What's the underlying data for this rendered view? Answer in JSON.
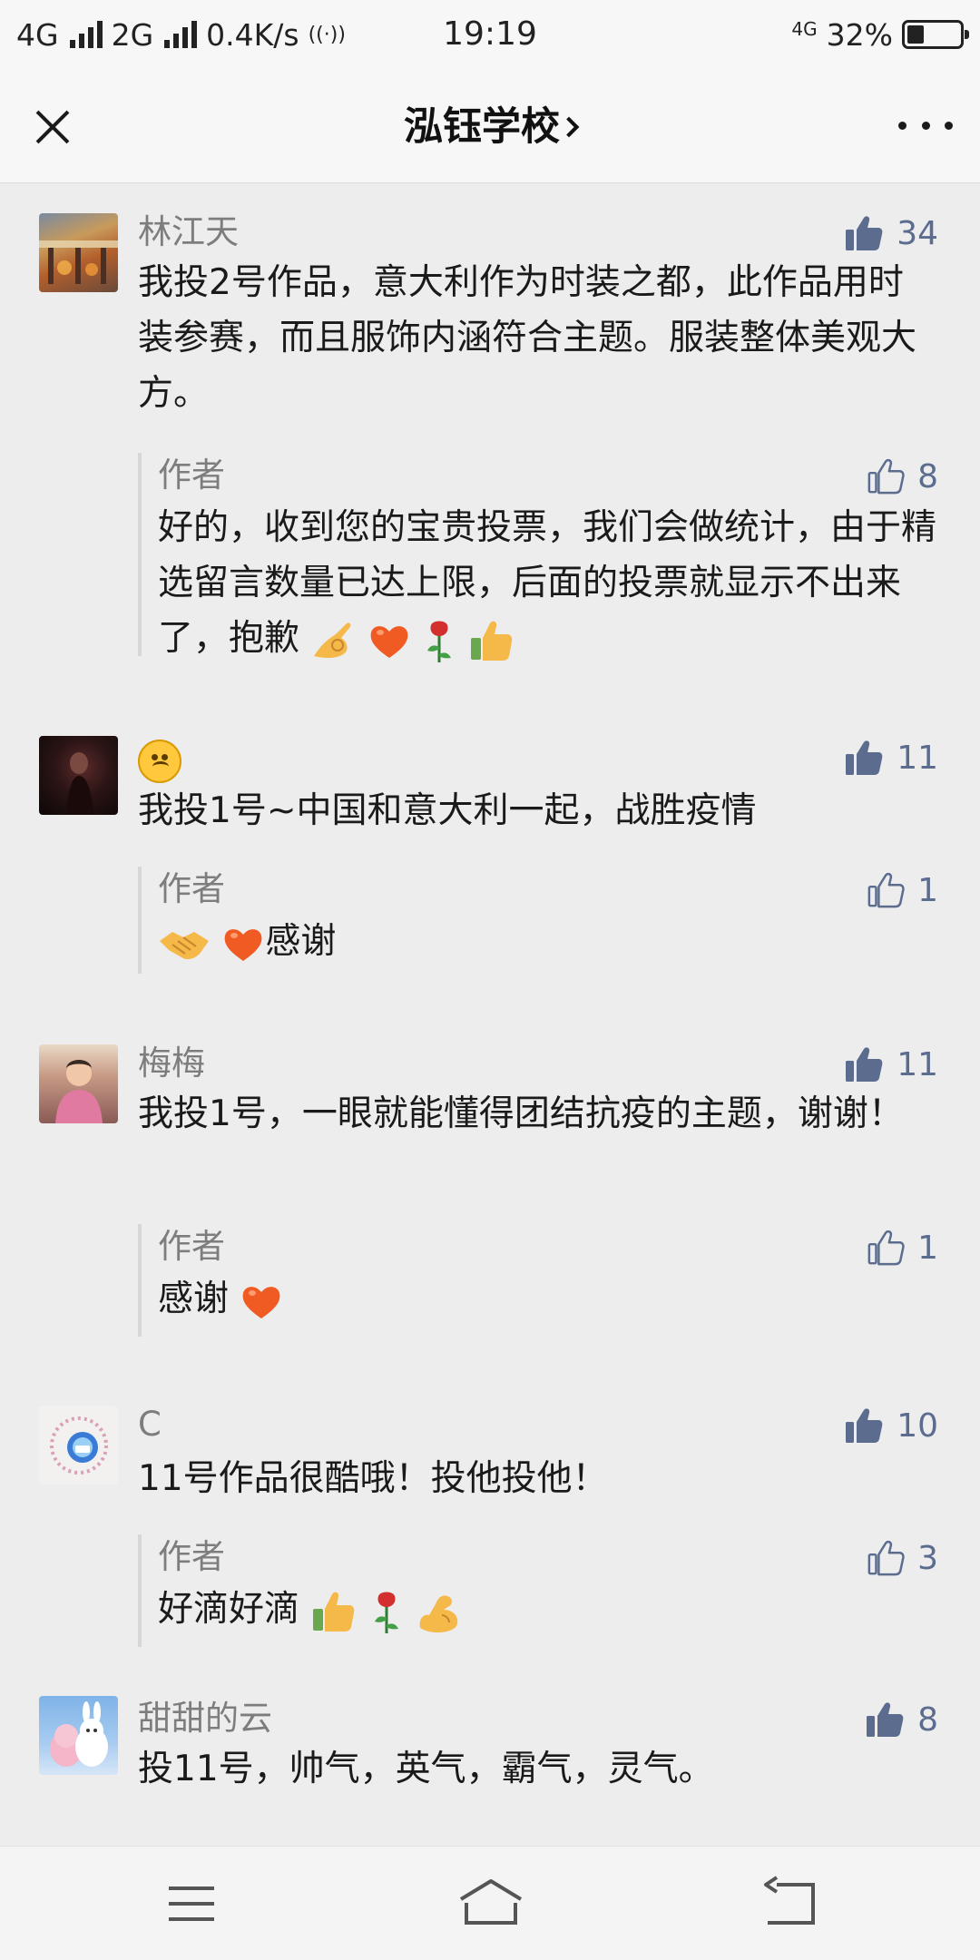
{
  "status_bar": {
    "network1": "4G",
    "network2": "2G",
    "speed": "0.4K/s",
    "time": "19:19",
    "network3": "4G",
    "battery": "32%",
    "battery_level": 0.32
  },
  "header": {
    "title": "泓钰学校",
    "close_icon": "close-icon",
    "more_icon": "more-icon"
  },
  "comments": [
    {
      "nickname": "林江天",
      "likes": "34",
      "text": "我投2号作品，意大利作为时装之都，此作品用时装参赛，而且服饰内涵符合主题。服装整体美观大方。",
      "reply": {
        "author": "作者",
        "likes": "8",
        "text": "好的，收到您的宝贵投票，我们会做统计，由于精选留言数量已达上限，后面的投票就显示不出来了，抱歉"
      }
    },
    {
      "nickname_icon": "upside-down-face-emoji",
      "likes": "11",
      "text": "我投1号~中国和意大利一起，战胜疫情",
      "reply": {
        "author": "作者",
        "likes": "1",
        "text": "感谢"
      }
    },
    {
      "nickname": "梅梅",
      "likes": "11",
      "text": "我投1号，一眼就能懂得团结抗疫的主题，谢谢！",
      "reply": {
        "author": "作者",
        "likes": "1",
        "text": "感谢"
      }
    },
    {
      "nickname": "C",
      "likes": "10",
      "text": "11号作品很酷哦！投他投他！",
      "reply": {
        "author": "作者",
        "likes": "3",
        "text": "好滴好滴"
      }
    },
    {
      "nickname": "甜甜的云",
      "likes": "8",
      "text": "投11号，帅气，英气，霸气，灵气。"
    }
  ],
  "colors": {
    "like_blue": "#5b6c8f",
    "background": "#ededed",
    "nickname_gray": "#7d7d7d"
  }
}
